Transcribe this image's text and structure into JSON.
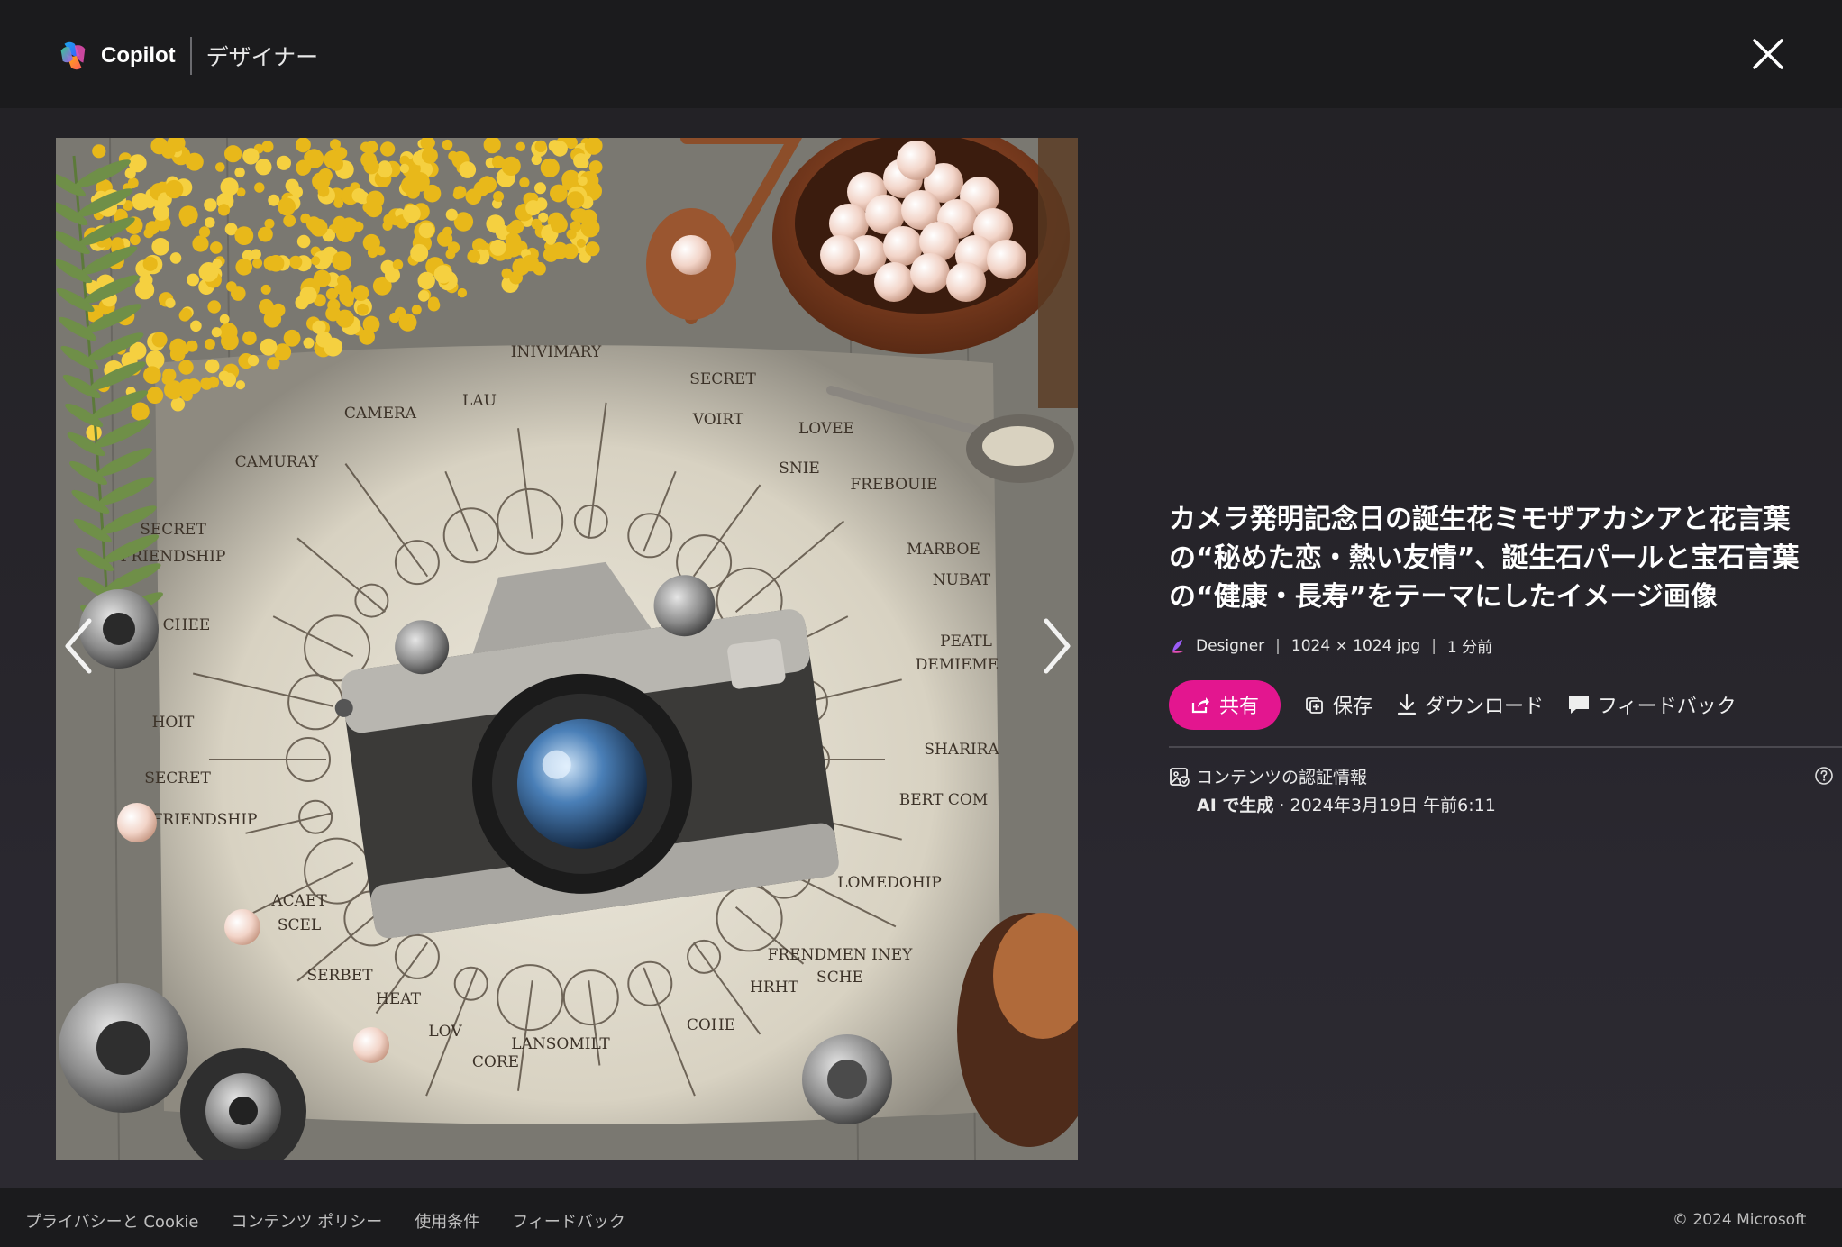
{
  "header": {
    "brand": "Copilot",
    "section": "デザイナー",
    "close_icon": "close-icon"
  },
  "image": {
    "alt": "",
    "nav_prev_icon": "chevron-left-icon",
    "nav_next_icon": "chevron-right-icon",
    "art_words": [
      "INIVIMARY",
      "SECRET",
      "LAU",
      "CAMERA",
      "VOIRT",
      "LOVEE",
      "CAMURAY",
      "SNIE",
      "FREBOUIE",
      "SECRET",
      "FRIENDSHIP",
      "MARBOE",
      "NUBAT",
      "CHEE",
      "PEATL",
      "DEMIEME",
      "HOIT",
      "SHARIRA",
      "SECRET",
      "BERT COM",
      "FRIENDSHIP",
      "LOMEDOHIP",
      "ACAET",
      "SCEL",
      "FRENDMEN INEY",
      "SERBET",
      "HEAT",
      "SCHE",
      "HRHT",
      "LOV",
      "COHE",
      "LANSOMILT",
      "CORE"
    ]
  },
  "info": {
    "title": "カメラ発明記念日の誕生花ミモザアカシアと花言葉の“秘めた恋・熱い友情”、誕生石パールと宝石言葉の“健康・長寿”をテーマにしたイメージ画像",
    "meta": {
      "app": "Designer",
      "dimensions": "1024 × 1024 jpg",
      "age": "1 分前",
      "separator": "|"
    },
    "actions": {
      "share": "共有",
      "save": "保存",
      "download": "ダウンロード",
      "feedback": "フィードバック"
    },
    "credentials": {
      "label": "コンテンツの認証情報",
      "ai_label": "AI で生成",
      "date": " · 2024年3月19日 午前6:11"
    }
  },
  "footer": {
    "links": [
      "プライバシーと Cookie",
      "コンテンツ ポリシー",
      "使用条件",
      "フィードバック"
    ],
    "copyright": "© 2024 Microsoft"
  },
  "colors": {
    "accent": "#e3168f",
    "background": "#1b1b1d"
  }
}
